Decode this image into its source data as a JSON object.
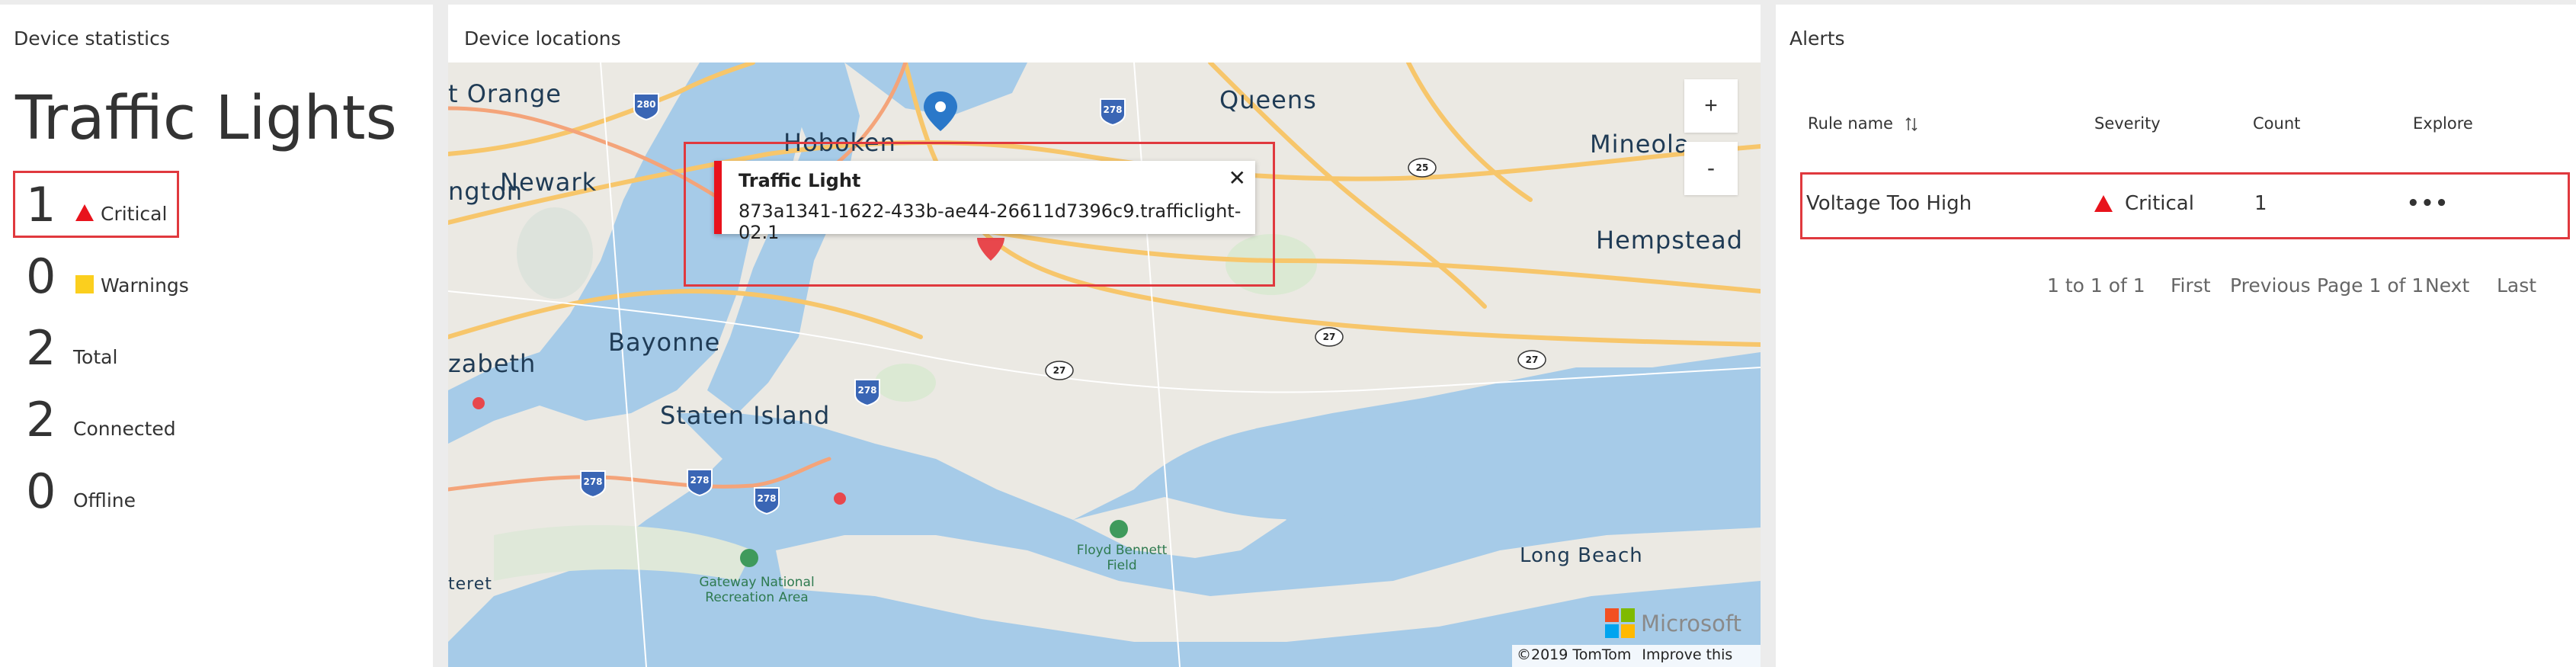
{
  "stats": {
    "title": "Device statistics",
    "heading": "Traffic Lights",
    "items": [
      {
        "count": "1",
        "label": "Critical",
        "icon": "critical-triangle-icon"
      },
      {
        "count": "0",
        "label": "Warnings",
        "icon": "warning-square-icon"
      },
      {
        "count": "2",
        "label": "Total"
      },
      {
        "count": "2",
        "label": "Connected"
      },
      {
        "count": "0",
        "label": "Offline"
      }
    ]
  },
  "map": {
    "title": "Device locations",
    "zoom_in": "+",
    "zoom_out": "-",
    "labels": {
      "orange": "t Orange",
      "hoboken": "Hoboken",
      "queens": "Queens",
      "mineola": "Mineola",
      "newark": "Newark",
      "ngton": "ngton",
      "hempstead": "Hempstead",
      "bayonne": "Bayonne",
      "elizabeth": "zabeth",
      "staten": "Staten Island",
      "teret": "teret",
      "gateway": "Gateway National Recreation Area",
      "floyd": "Floyd Bennett Field",
      "longbeach": "Long Beach"
    },
    "shields": [
      "280",
      "278",
      "278",
      "278",
      "278",
      "278",
      "25",
      "27",
      "27",
      "27"
    ],
    "popup": {
      "title": "Traffic Light",
      "device_id": "873a1341-1622-433b-ae44-26611d7396c9.trafficlight-02.1",
      "close": "✕"
    },
    "brand": "Microsoft",
    "attribution": "©2019 TomTom",
    "improve": "Improve this map"
  },
  "alerts": {
    "title": "Alerts",
    "columns": {
      "rule": "Rule name",
      "severity": "Severity",
      "count": "Count",
      "explore": "Explore"
    },
    "rows": [
      {
        "rule": "Voltage Too High",
        "severity": "Critical",
        "count": "1",
        "explore": "•••"
      }
    ],
    "pager": {
      "range": "1 to 1 of 1",
      "first": "First",
      "previous": "Previous",
      "page": "Page 1 of 1",
      "next": "Next",
      "last": "Last"
    }
  },
  "colors": {
    "critical": "#e8131c",
    "warning": "#fbcf1e",
    "highlight": "#e0393e",
    "water": "#a6cbe8",
    "land": "#ebe9e3",
    "road": "#f7c66b"
  }
}
